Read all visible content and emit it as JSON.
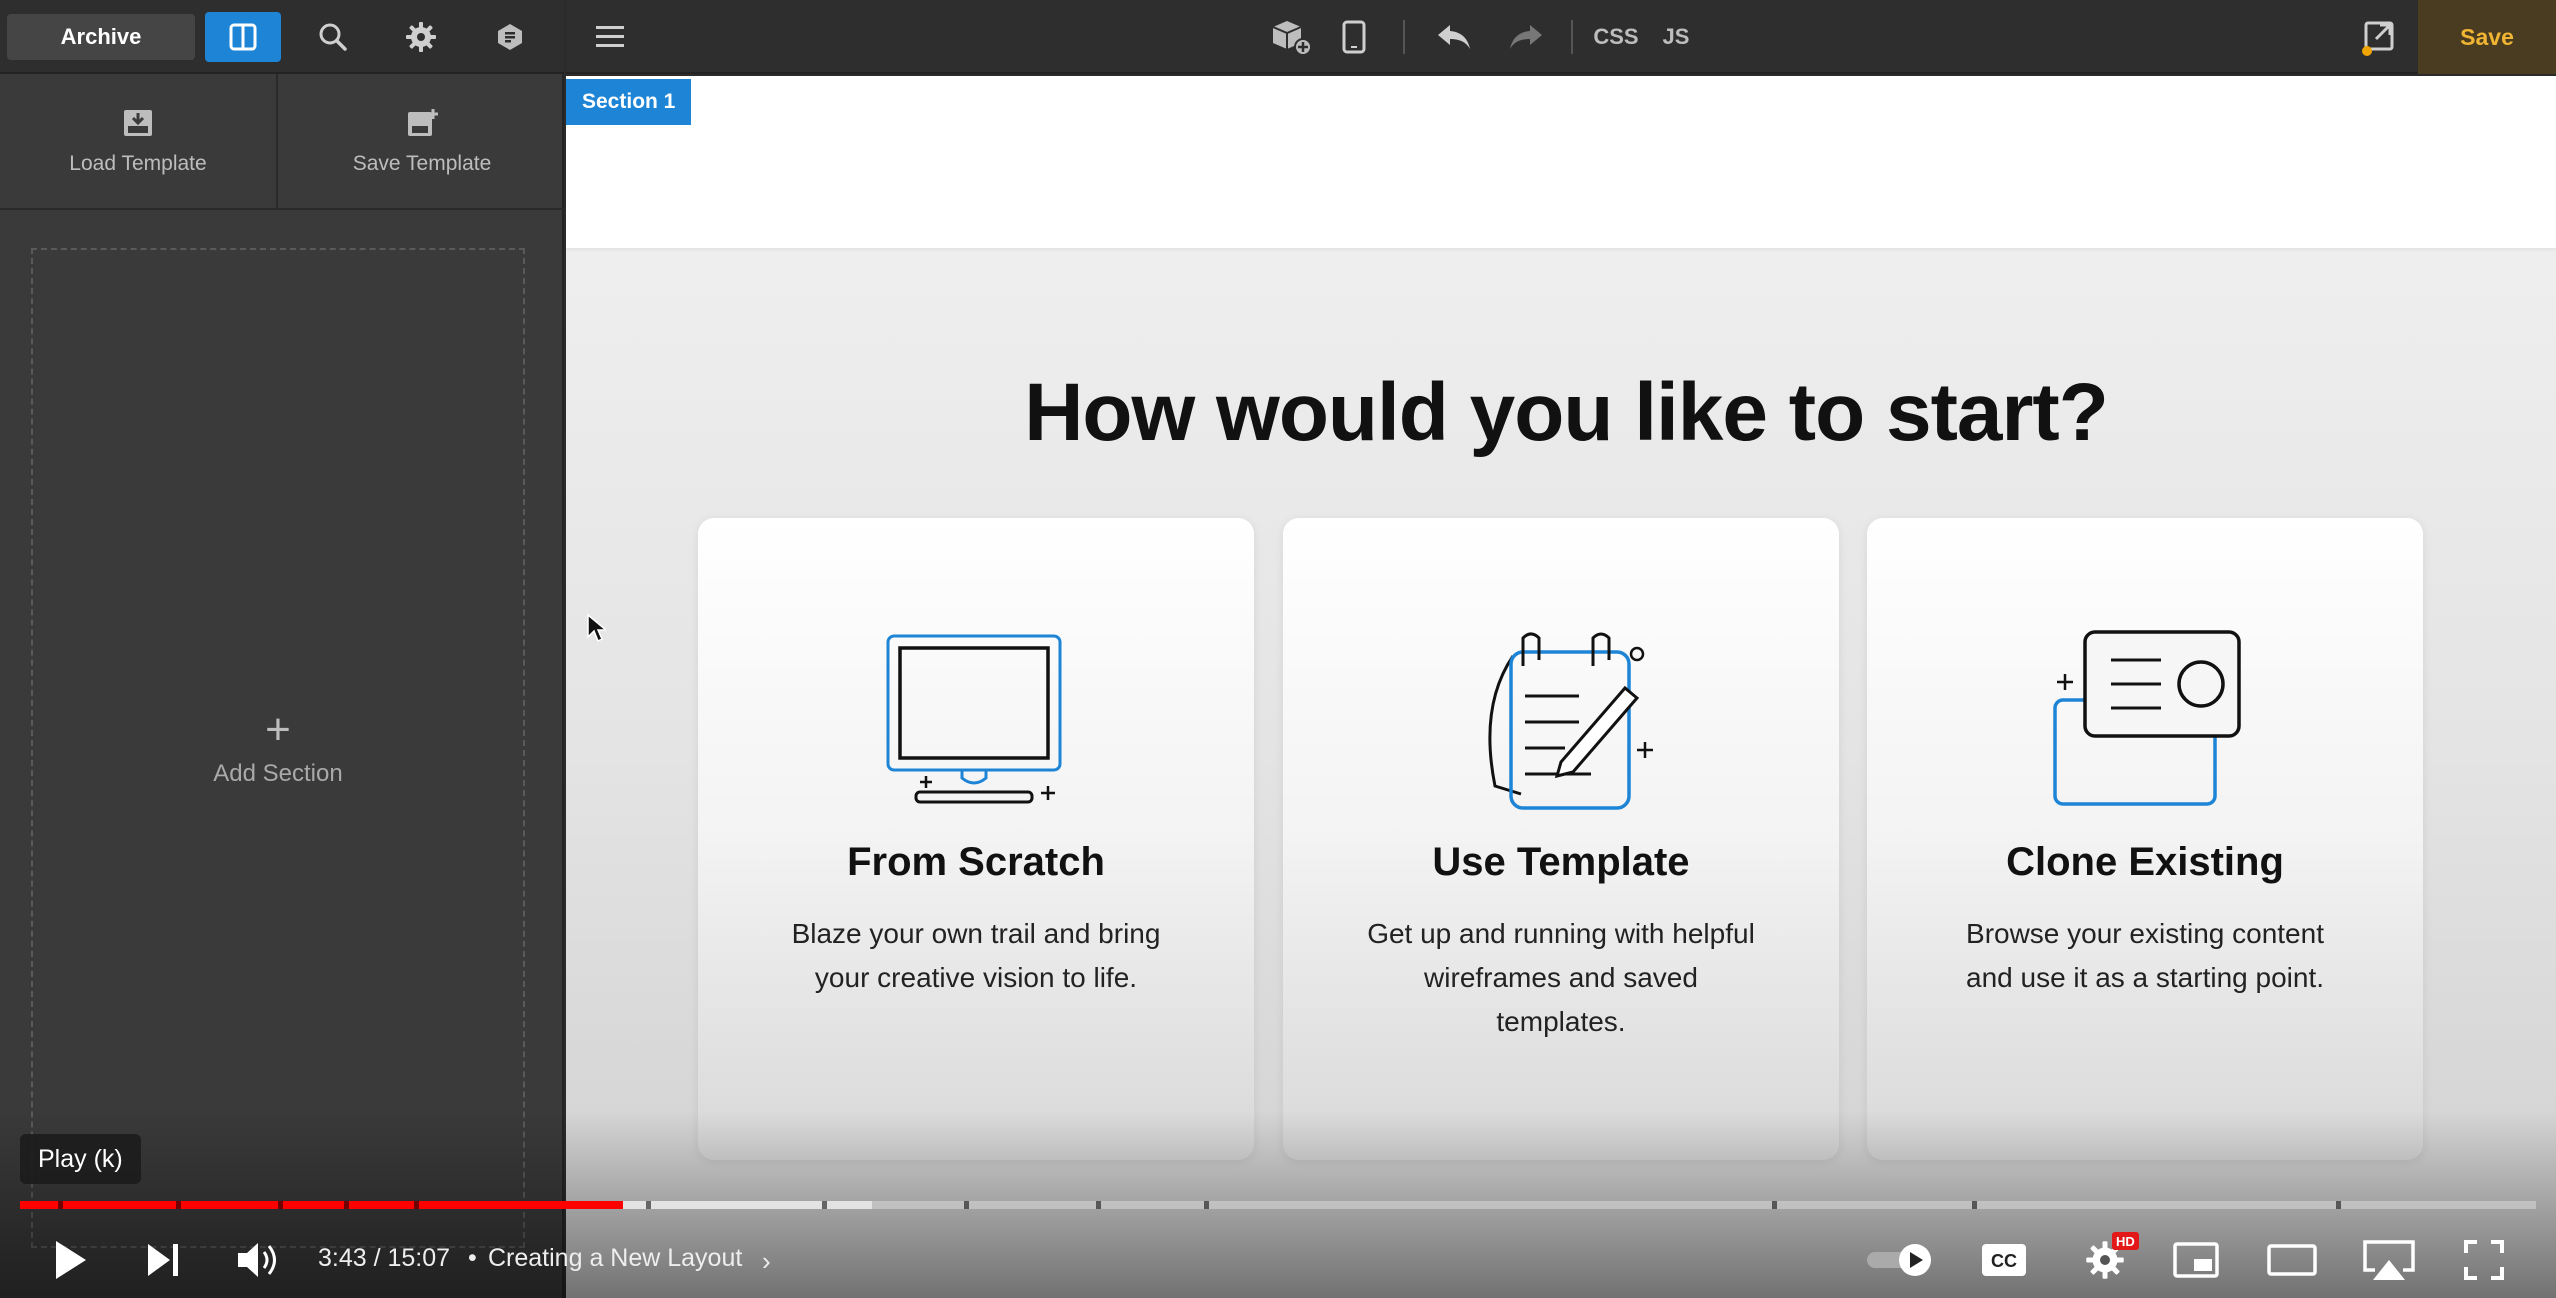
{
  "sidebar": {
    "archive_label": "Archive",
    "load_template": "Load Template",
    "save_template": "Save Template",
    "add_section": "Add Section",
    "add_plus": "+"
  },
  "toolbar": {
    "css_label": "CSS",
    "js_label": "JS",
    "save_label": "Save"
  },
  "canvas": {
    "section_label": "Section 1",
    "heading": "How would you like to start?",
    "cards": [
      {
        "title": "From Scratch",
        "description": "Blaze your own trail and bring your creative vision to life."
      },
      {
        "title": "Use Template",
        "description": "Get up and running with helpful wireframes and saved templates."
      },
      {
        "title": "Clone Existing",
        "description": "Browse your existing content and use it as a starting point."
      }
    ]
  },
  "player": {
    "tooltip": "Play (k)",
    "time": "3:43 / 15:07",
    "separator": "•",
    "chapter": "Creating a New Layout",
    "chevron": "›",
    "hd_badge": "HD",
    "progress_played": 0.2395,
    "progress_buffered": 0.3385
  },
  "colors": {
    "accent": "#1d84d6",
    "save_text": "#f0b533",
    "progress": "#ff0000"
  },
  "icons": {
    "panel": "panel-layout-icon",
    "search": "search-icon",
    "settings": "gear-icon",
    "wordpress": "wordpress-icon",
    "load": "load-template-icon",
    "save": "save-template-icon",
    "menu": "hamburger-menu-icon",
    "structure": "structure-icon",
    "responsive": "tablet-icon",
    "undo": "undo-icon",
    "redo": "redo-icon",
    "preview": "preview-icon"
  }
}
